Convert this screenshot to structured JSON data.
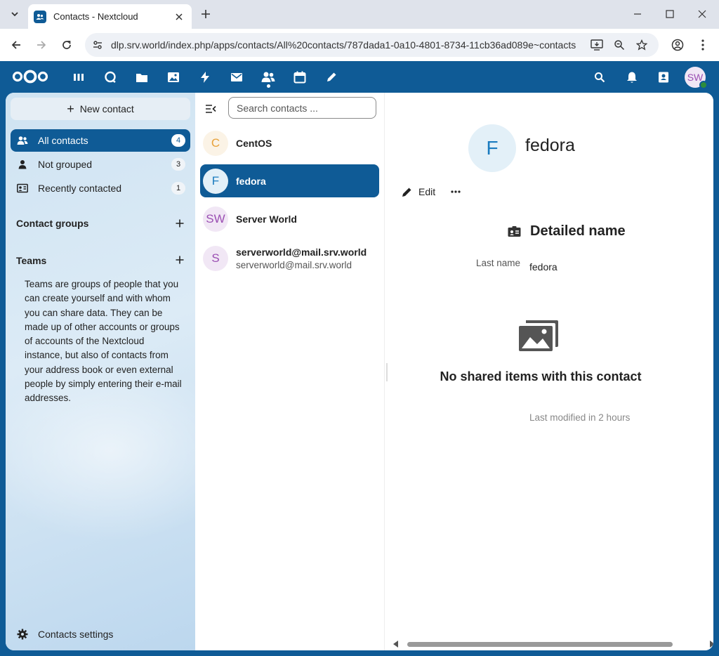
{
  "browser": {
    "tab_title": "Contacts - Nextcloud",
    "url": "dlp.srv.world/index.php/apps/contacts/All%20contacts/787dada1-0a10-4801-8734-11cb36ad089e~contacts"
  },
  "header": {
    "apps": [
      "dashboard-icon",
      "talk-icon",
      "files-icon",
      "photos-icon",
      "activity-icon",
      "mail-icon",
      "contacts-icon",
      "calendar-icon",
      "notes-icon"
    ],
    "avatar_initials": "SW"
  },
  "sidebar": {
    "new_contact": "New contact",
    "items": [
      {
        "label": "All contacts",
        "count": "4"
      },
      {
        "label": "Not grouped",
        "count": "3"
      },
      {
        "label": "Recently contacted",
        "count": "1"
      }
    ],
    "contact_groups": "Contact groups",
    "teams": "Teams",
    "teams_description": "Teams are groups of people that you can create yourself and with whom you can share data. They can be made up of other accounts or groups of accounts of the Nextcloud instance, but also of contacts from your address book or even external people by simply entering their e-mail addresses.",
    "settings": "Contacts settings"
  },
  "list": {
    "search_placeholder": "Search contacts ...",
    "contacts": [
      {
        "initials": "C",
        "name": "CentOS",
        "sub": "",
        "color": "#e8a23a",
        "bg": "#fbf3e6"
      },
      {
        "initials": "F",
        "name": "fedora",
        "sub": "",
        "color": "#1a7bbf",
        "bg": "#e3f0f8"
      },
      {
        "initials": "SW",
        "name": "Server World",
        "sub": "",
        "color": "#9b4fb3",
        "bg": "#f1e7f5"
      },
      {
        "initials": "S",
        "name": "serverworld@mail.srv.world",
        "sub": "serverworld@mail.srv.world",
        "color": "#9b4fb3",
        "bg": "#f1e7f5"
      }
    ]
  },
  "detail": {
    "avatar_initial": "F",
    "name": "fedora",
    "edit": "Edit",
    "section": "Detailed name",
    "last_name_label": "Last name",
    "last_name_value": "fedora",
    "empty_text": "No shared items with this contact",
    "modified": "Last modified in 2 hours"
  },
  "colors": {
    "brand": "#0f5b96",
    "active_item": "#0f5b96"
  }
}
